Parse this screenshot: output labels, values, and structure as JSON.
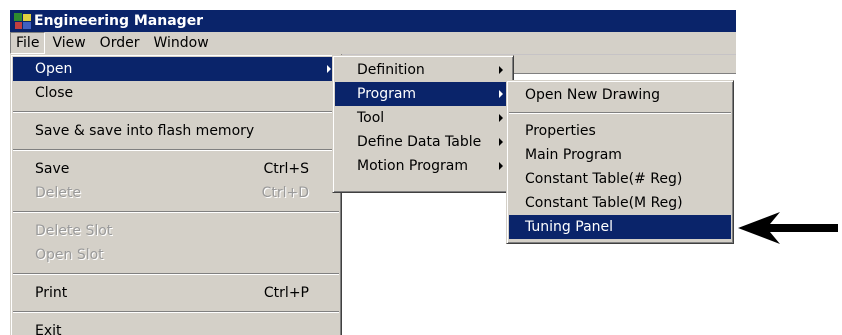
{
  "window": {
    "title": "Engineering Manager"
  },
  "menubar": {
    "items": [
      "File",
      "View",
      "Order",
      "Window"
    ]
  },
  "file_menu": {
    "open": "Open",
    "close": "Close",
    "save_flash": "Save & save into flash memory",
    "save": "Save",
    "save_shortcut": "Ctrl+S",
    "delete": "Delete",
    "delete_shortcut": "Ctrl+D",
    "delete_slot": "Delete Slot",
    "open_slot": "Open Slot",
    "print": "Print",
    "print_shortcut": "Ctrl+P",
    "exit": "Exit"
  },
  "open_submenu": {
    "items": [
      "Definition",
      "Program",
      "Tool",
      "Define Data Table",
      "Motion Program"
    ],
    "selected": "Program"
  },
  "program_submenu": {
    "open_new_drawing": "Open New Drawing",
    "items": [
      "Properties",
      "Main Program",
      "Constant Table(# Reg)",
      "Constant Table(M Reg)",
      "Tuning Panel"
    ],
    "selected": "Tuning Panel"
  },
  "colors": {
    "title_bar": "#0a246a",
    "menu_highlight": "#0a246a",
    "menu_bg": "#d4d0c8",
    "disabled_text": "#9a9a9a"
  },
  "icons": {
    "app": "app-icon",
    "pointer": "pointer-arrow-icon",
    "submenu": "chevron-right-icon"
  }
}
